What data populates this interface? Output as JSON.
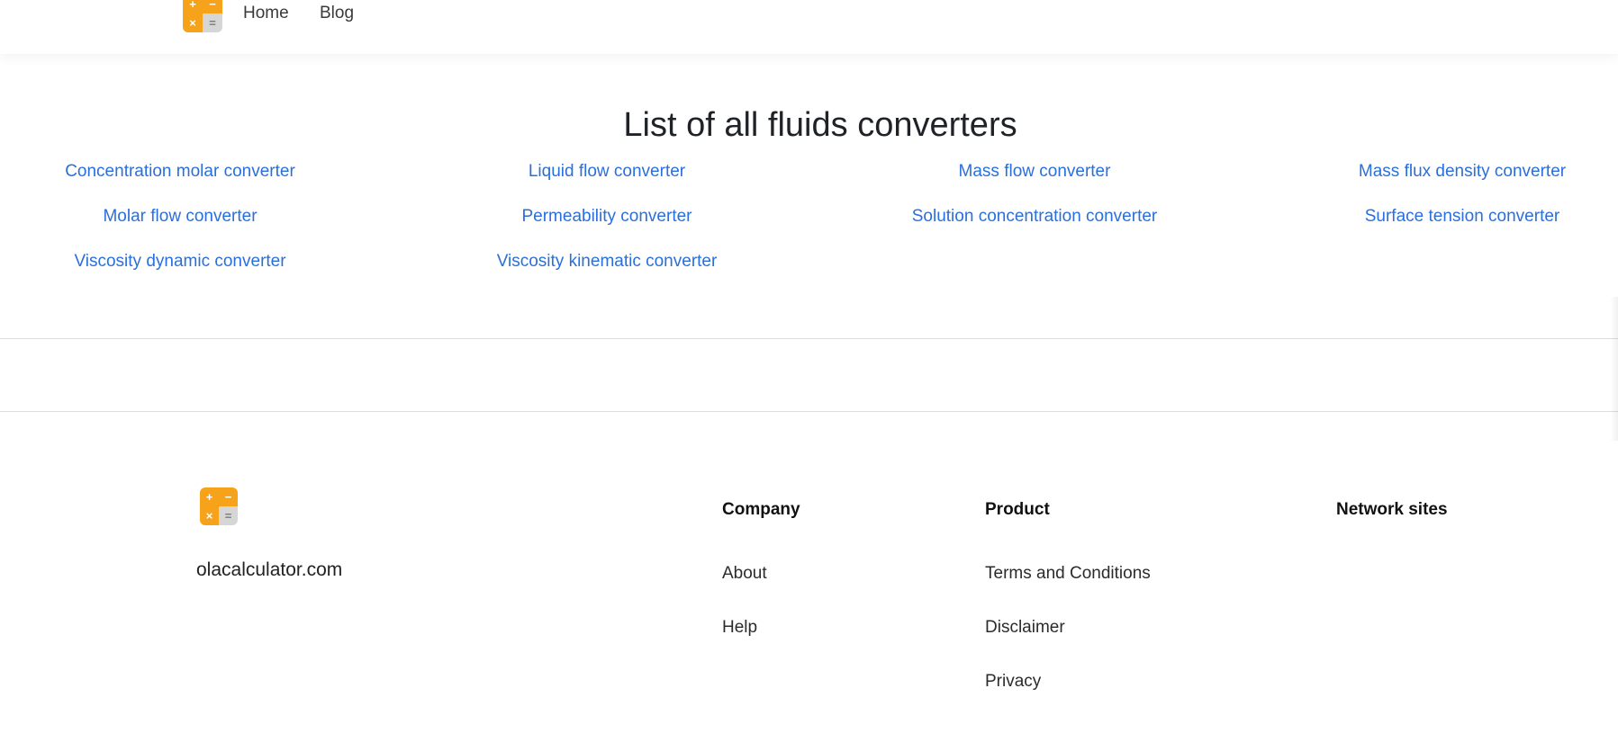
{
  "header": {
    "logo": {
      "cells": [
        "+",
        "−",
        "×",
        "="
      ]
    },
    "nav": [
      {
        "label": "Home"
      },
      {
        "label": "Blog"
      }
    ]
  },
  "main": {
    "title": "List of all fluids converters",
    "converters": [
      {
        "label": "Concentration molar converter"
      },
      {
        "label": "Liquid flow converter"
      },
      {
        "label": "Mass flow converter"
      },
      {
        "label": "Mass flux density converter"
      },
      {
        "label": "Molar flow converter"
      },
      {
        "label": "Permeability converter"
      },
      {
        "label": "Solution concentration converter"
      },
      {
        "label": "Surface tension converter"
      },
      {
        "label": "Viscosity dynamic converter"
      },
      {
        "label": "Viscosity kinematic converter"
      }
    ]
  },
  "footer": {
    "logo": {
      "cells": [
        "+",
        "−",
        "×",
        "="
      ]
    },
    "site_name": "olacalculator.com",
    "company": {
      "heading": "Company",
      "links": [
        {
          "label": "About"
        },
        {
          "label": "Help"
        }
      ]
    },
    "product": {
      "heading": "Product",
      "links": [
        {
          "label": "Terms and Conditions"
        },
        {
          "label": "Disclaimer"
        },
        {
          "label": "Privacy"
        }
      ]
    },
    "network": {
      "heading": "Network sites"
    }
  },
  "colors": {
    "link": "#2a6fdb",
    "logo_orange": "#f7a21b",
    "logo_gray": "#d6d6d6"
  }
}
